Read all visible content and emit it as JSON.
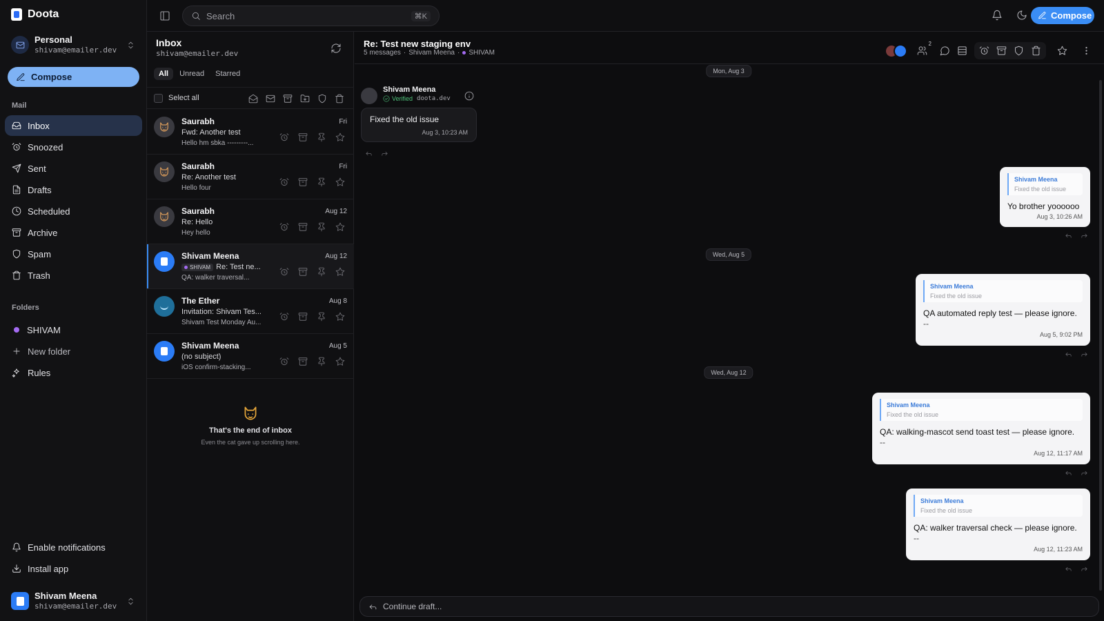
{
  "app": {
    "name": "Doota"
  },
  "account": {
    "name": "Personal",
    "email": "shivam@emailer.dev"
  },
  "sidebar": {
    "compose_label": "Compose",
    "mail_section": "Mail",
    "items": [
      {
        "label": "Inbox",
        "icon": "inbox-icon"
      },
      {
        "label": "Snoozed",
        "icon": "alarm-icon"
      },
      {
        "label": "Sent",
        "icon": "send-icon"
      },
      {
        "label": "Drafts",
        "icon": "file-icon"
      },
      {
        "label": "Scheduled",
        "icon": "clock-icon"
      },
      {
        "label": "Archive",
        "icon": "archive-icon"
      },
      {
        "label": "Spam",
        "icon": "shield-icon"
      },
      {
        "label": "Trash",
        "icon": "trash-icon"
      }
    ],
    "folders_section": "Folders",
    "folders": [
      {
        "label": "SHIVAM",
        "color": "#a46bf2"
      }
    ],
    "new_folder_label": "New folder",
    "rules_label": "Rules",
    "enable_notifications_label": "Enable notifications",
    "install_app_label": "Install app"
  },
  "user": {
    "name": "Shivam Meena",
    "email": "shivam@emailer.dev"
  },
  "topbar": {
    "search_placeholder": "Search",
    "search_shortcut": "⌘K",
    "compose_label": "Compose"
  },
  "list": {
    "title": "Inbox",
    "email": "shivam@emailer.dev",
    "filters": [
      "All",
      "Unread",
      "Starred"
    ],
    "select_all_label": "Select all",
    "messages": [
      {
        "from": "Saurabh",
        "date": "Fri",
        "subject": "Fwd: Another test",
        "preview": "Hello hm sbka ---------...",
        "avatar": "cat",
        "tag": ""
      },
      {
        "from": "Saurabh",
        "date": "Fri",
        "subject": "Re: Another test",
        "preview": "Hello four",
        "avatar": "cat",
        "tag": ""
      },
      {
        "from": "Saurabh",
        "date": "Aug 12",
        "subject": "Re: Hello",
        "preview": "Hey hello",
        "avatar": "cat",
        "tag": ""
      },
      {
        "from": "Shivam Meena",
        "date": "Aug 12",
        "subject": "Re: Test ne...",
        "preview": "QA: walker traversal...",
        "avatar": "blue",
        "tag": "SHIVAM"
      },
      {
        "from": "The Ether",
        "date": "Aug 8",
        "subject": "Invitation: Shivam Tes...",
        "preview": "Shivam Test Monday Au...",
        "avatar": "teal",
        "tag": ""
      },
      {
        "from": "Shivam Meena",
        "date": "Aug 5",
        "subject": "(no subject)",
        "preview": "iOS confirm-stacking...",
        "avatar": "blue",
        "tag": ""
      }
    ],
    "end_title": "That's the end of inbox",
    "end_sub": "Even the cat gave up scrolling here."
  },
  "thread": {
    "title": "Re: Test new staging env",
    "meta_count": "5 messages",
    "meta_sender": "Shivam Meena",
    "meta_label": "SHIVAM",
    "participants_count": "2",
    "dates": [
      "Mon, Aug 3",
      "Wed, Aug 5",
      "Wed, Aug 12"
    ],
    "first_message": {
      "sender": "Shivam Meena",
      "verified_label": "Verified",
      "domain": "doota.dev",
      "text": "Fixed the old issue",
      "time": "Aug 3, 10:23 AM"
    },
    "replies": [
      {
        "quote_name": "Shivam Meena",
        "quote_text": "Fixed the old issue",
        "text": "Yo brother yoooooo",
        "sig": "",
        "time": "Aug 3, 10:26 AM"
      },
      {
        "quote_name": "Shivam Meena",
        "quote_text": "Fixed the old issue",
        "text": "QA automated reply test — please ignore.",
        "sig": "--",
        "time": "Aug 5, 9:02 PM"
      },
      {
        "quote_name": "Shivam Meena",
        "quote_text": "Fixed the old issue",
        "text": "QA: walking-mascot send toast test — please ignore.",
        "sig": "--",
        "time": "Aug 12, 11:17 AM"
      },
      {
        "quote_name": "Shivam Meena",
        "quote_text": "Fixed the old issue",
        "text": "QA: walker traversal check — please ignore.",
        "sig": "--",
        "time": "Aug 12, 11:23 AM"
      }
    ],
    "draft_label": "Continue draft..."
  },
  "colors": {
    "accent": "#3a8df5",
    "compose_side": "#7eb2f4",
    "folder": "#a46bf2",
    "verified": "#4fc27a"
  }
}
